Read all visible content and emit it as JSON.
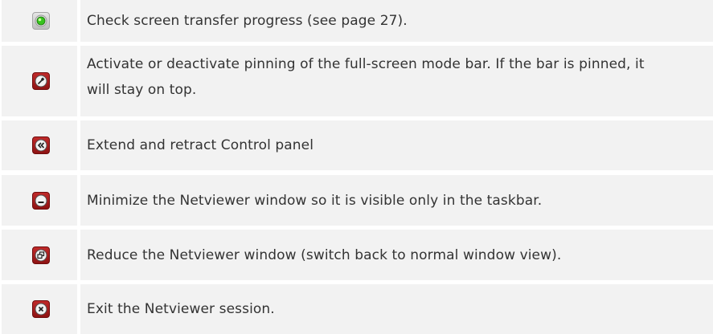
{
  "rows": [
    {
      "icon": "status-green-icon",
      "text": "Check screen transfer progress (see page 27)."
    },
    {
      "icon": "pin-icon",
      "text": "Activate or deactivate pinning of the full-screen mode bar. If the bar is pinned, it will stay on top."
    },
    {
      "icon": "double-chevron-left-icon",
      "text": "Extend and retract Control panel"
    },
    {
      "icon": "minimize-icon",
      "text": "Minimize the Netviewer window so it is visible only in the taskbar."
    },
    {
      "icon": "restore-window-icon",
      "text": "Reduce the Netviewer window (switch back to normal window view)."
    },
    {
      "icon": "close-icon",
      "text": "Exit the Netviewer session."
    }
  ],
  "colors": {
    "row_background": "#f2f2f2",
    "text": "#333333",
    "button_red": "#b01f1f",
    "status_green": "#33c21b"
  }
}
